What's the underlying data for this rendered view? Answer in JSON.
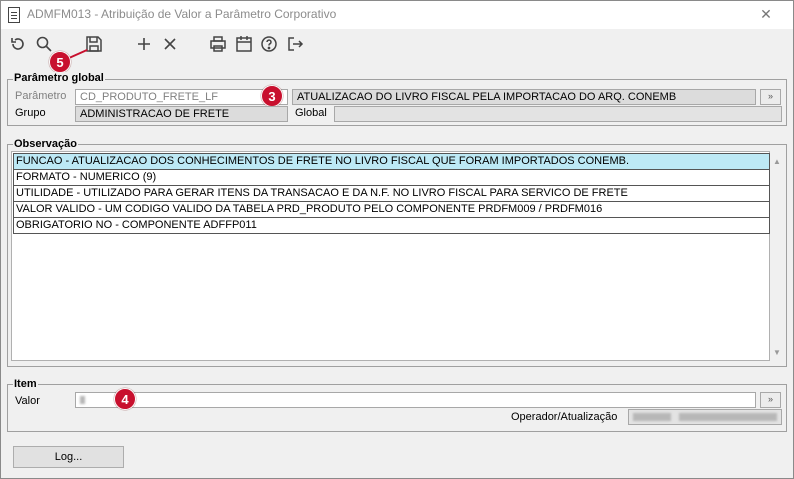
{
  "window": {
    "title": "ADMFM013 - Atribuição de Valor a Parâmetro Corporativo",
    "close_glyph": "✕"
  },
  "toolbar": {
    "icons": [
      "undo-icon",
      "search-icon",
      "save-icon",
      "add-icon",
      "delete-icon",
      "print-icon",
      "calendar-icon",
      "help-icon",
      "exit-icon"
    ]
  },
  "badges": {
    "b3": "3",
    "b4": "4",
    "b5": "5"
  },
  "global": {
    "section_title": "Parâmetro global",
    "parametro_label": "Parâmetro",
    "parametro_value": "CD_PRODUTO_FRETE_LF",
    "parametro_description": "ATUALIZACAO DO LIVRO FISCAL PELA IMPORTACAO DO ARQ. CONEMB",
    "grupo_label": "Grupo",
    "grupo_value": "ADMINISTRACAO DE FRETE",
    "global_label": "Global",
    "global_value": "",
    "lookup_glyph": "»"
  },
  "observacao": {
    "section_title": "Observação",
    "lines": [
      "FUNCAO - ATUALIZACAO DOS CONHECIMENTOS DE FRETE NO LIVRO FISCAL QUE FORAM IMPORTADOS CONEMB.",
      "FORMATO - NUMERICO (9)",
      "UTILIDADE - UTILIZADO PARA GERAR ITENS DA TRANSACAO E DA N.F.  NO LIVRO FISCAL PARA SERVICO DE FRETE",
      "VALOR VALIDO - UM CODIGO VALIDO DA TABELA PRD_PRODUTO PELO COMPONENTE PRDFM009 / PRDFM016",
      "OBRIGATORIO NO - COMPONENTE ADFFP011"
    ],
    "selected_index": 0
  },
  "item": {
    "section_title": "Item",
    "valor_label": "Valor",
    "valor_value": "",
    "operador_label": "Operador/Atualização",
    "lookup_glyph": "»"
  },
  "footer": {
    "log_label": "Log..."
  },
  "colors": {
    "badge": "#c8102e",
    "selected_row": "#bde9f5",
    "readonly_field": "#dcdcdc"
  }
}
